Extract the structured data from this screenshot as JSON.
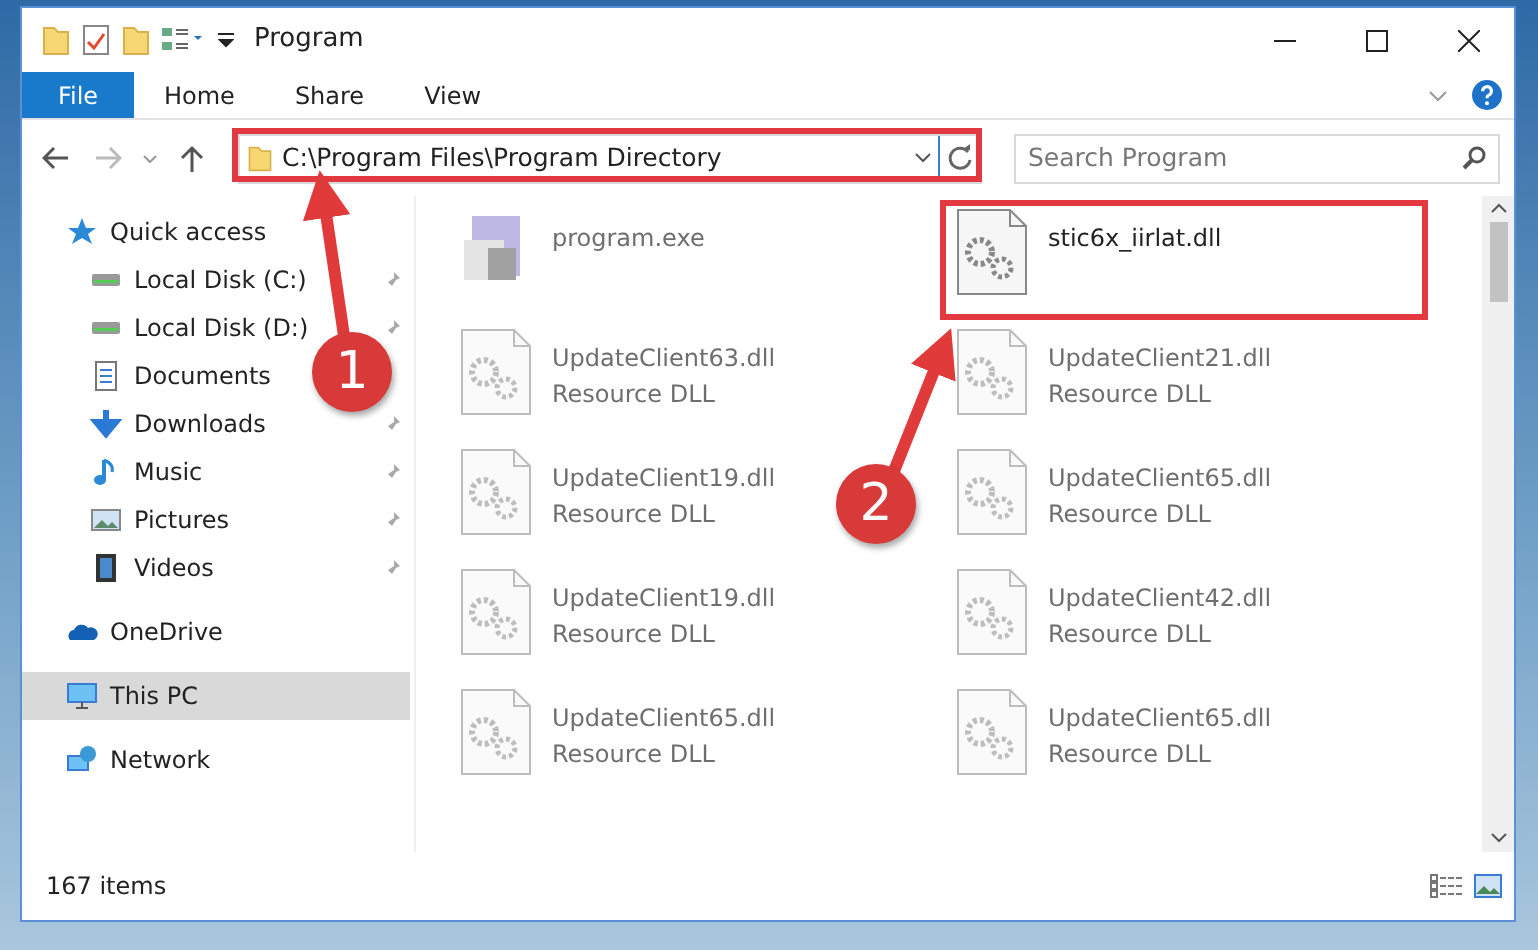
{
  "window": {
    "title": "Program"
  },
  "ribbon_tabs": [
    {
      "label": "File",
      "kind": "file"
    },
    {
      "label": "Home",
      "kind": "tab"
    },
    {
      "label": "Share",
      "kind": "tab"
    },
    {
      "label": "View",
      "kind": "tab"
    }
  ],
  "address_bar": {
    "path": "C:\\Program Files\\Program Directory"
  },
  "search": {
    "placeholder": "Search Program"
  },
  "sidebar": {
    "items": [
      {
        "label": "Quick access",
        "kind": "star",
        "selected": false,
        "children": [
          {
            "label": "Local Disk (C:)",
            "kind": "drive",
            "pinned": true,
            "selected": false
          },
          {
            "label": "Local Disk (D:)",
            "kind": "drive",
            "pinned": true,
            "selected": false
          },
          {
            "label": "Documents",
            "kind": "document",
            "pinned": false,
            "selected": false
          },
          {
            "label": "Downloads",
            "kind": "download",
            "pinned": true,
            "selected": false
          },
          {
            "label": "Music",
            "kind": "music",
            "pinned": true,
            "selected": false
          },
          {
            "label": "Pictures",
            "kind": "pictures",
            "pinned": true,
            "selected": false
          },
          {
            "label": "Videos",
            "kind": "videos",
            "pinned": true,
            "selected": false
          }
        ]
      },
      {
        "label": "OneDrive",
        "kind": "cloud",
        "selected": false
      },
      {
        "label": "This PC",
        "kind": "pc",
        "selected": true
      },
      {
        "label": "Network",
        "kind": "network",
        "selected": false
      }
    ]
  },
  "files": [
    {
      "name": "program.exe",
      "kind": "exe",
      "blurred": true
    },
    {
      "name": "stic6x_iirlat.dll",
      "kind": "dll",
      "blurred": false
    },
    {
      "name": "UpdateClient63.dll",
      "type": "Resource DLL",
      "kind": "dll",
      "blurred": true
    },
    {
      "name": "UpdateClient21.dll",
      "type": "Resource DLL",
      "kind": "dll",
      "blurred": true
    },
    {
      "name": "UpdateClient19.dll",
      "type": "Resource DLL",
      "kind": "dll",
      "blurred": true
    },
    {
      "name": "UpdateClient65.dll",
      "type": "Resource DLL",
      "kind": "dll",
      "blurred": true
    },
    {
      "name": "UpdateClient19.dll",
      "type": "Resource DLL",
      "kind": "dll",
      "blurred": true
    },
    {
      "name": "UpdateClient42.dll",
      "type": "Resource DLL",
      "kind": "dll",
      "blurred": true
    },
    {
      "name": "UpdateClient65.dll",
      "type": "Resource DLL",
      "kind": "dll",
      "blurred": true
    },
    {
      "name": "UpdateClient65.dll",
      "type": "Resource DLL",
      "kind": "dll",
      "blurred": true
    }
  ],
  "status_bar": {
    "item_count": "167 items"
  },
  "annotations": [
    {
      "label": "1"
    },
    {
      "label": "2"
    }
  ]
}
